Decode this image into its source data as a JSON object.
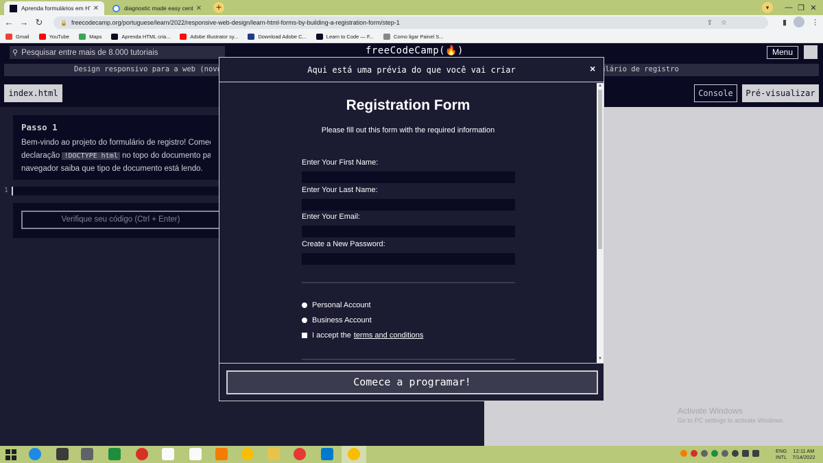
{
  "browser": {
    "tabs": [
      {
        "title": "Aprenda formulários em HTML c",
        "active": true
      },
      {
        "title": "diagnostic made easy centurion",
        "active": false
      }
    ],
    "url": "freecodecamp.org/portuguese/learn/2022/responsive-web-design/learn-html-forms-by-building-a-registration-form/step-1",
    "bookmarks": [
      "Gmail",
      "YouTube",
      "Maps",
      "Aprenda HTML cria...",
      "Adobe Illustrator sy...",
      "Download Adobe C...",
      "Learn to Code — F...",
      "Como ligar Painel S..."
    ]
  },
  "fcc": {
    "search_placeholder": "Pesquisar entre mais de 8.000 tutoriais",
    "logo": "freeCodeCamp(🔥)",
    "menu_label": "Menu",
    "breadcrumb_left": "Design responsivo para a web (novo)",
    "breadcrumb_right": "ulário de registro",
    "file_tab": "index.html",
    "console_label": "Console",
    "preview_label": "Pré-visualizar",
    "step": {
      "title": "Passo 1",
      "line1": "Bem-vindo ao projeto do formulário de registro! Comece ao",
      "line2_pre": "declaração ",
      "line2_code": "!DOCTYPE html",
      "line2_post": " no topo do documento para qu",
      "line3": "navegador saiba que tipo de documento está lendo."
    },
    "line_number": "1",
    "check_button": "Verifique seu código (Ctrl + Enter)"
  },
  "modal": {
    "title": "Aqui está uma prévia do que você vai criar",
    "close": "×",
    "start_button": "Comece a programar!",
    "preview": {
      "heading": "Registration Form",
      "subheading": "Please fill out this form with the required information",
      "fields": [
        "Enter Your First Name:",
        "Enter Your Last Name:",
        "Enter Your Email:",
        "Create a New Password:"
      ],
      "radios": [
        "Personal Account",
        "Business Account"
      ],
      "checkbox_pre": "I accept the",
      "checkbox_link": "terms and conditions"
    }
  },
  "windows": {
    "watermark_title": "Activate Windows",
    "watermark_sub": "Go to PC settings to activate Windows.",
    "lang_1": "ENG",
    "lang_2": "INTL",
    "time": "12:11 AM",
    "date": "7/14/2022"
  },
  "colors": {
    "fcc_bg": "#0a0a23",
    "fcc_panel": "#1b1b32",
    "fcc_light": "#d0d0d5",
    "taskbar": "#b8c97a"
  }
}
